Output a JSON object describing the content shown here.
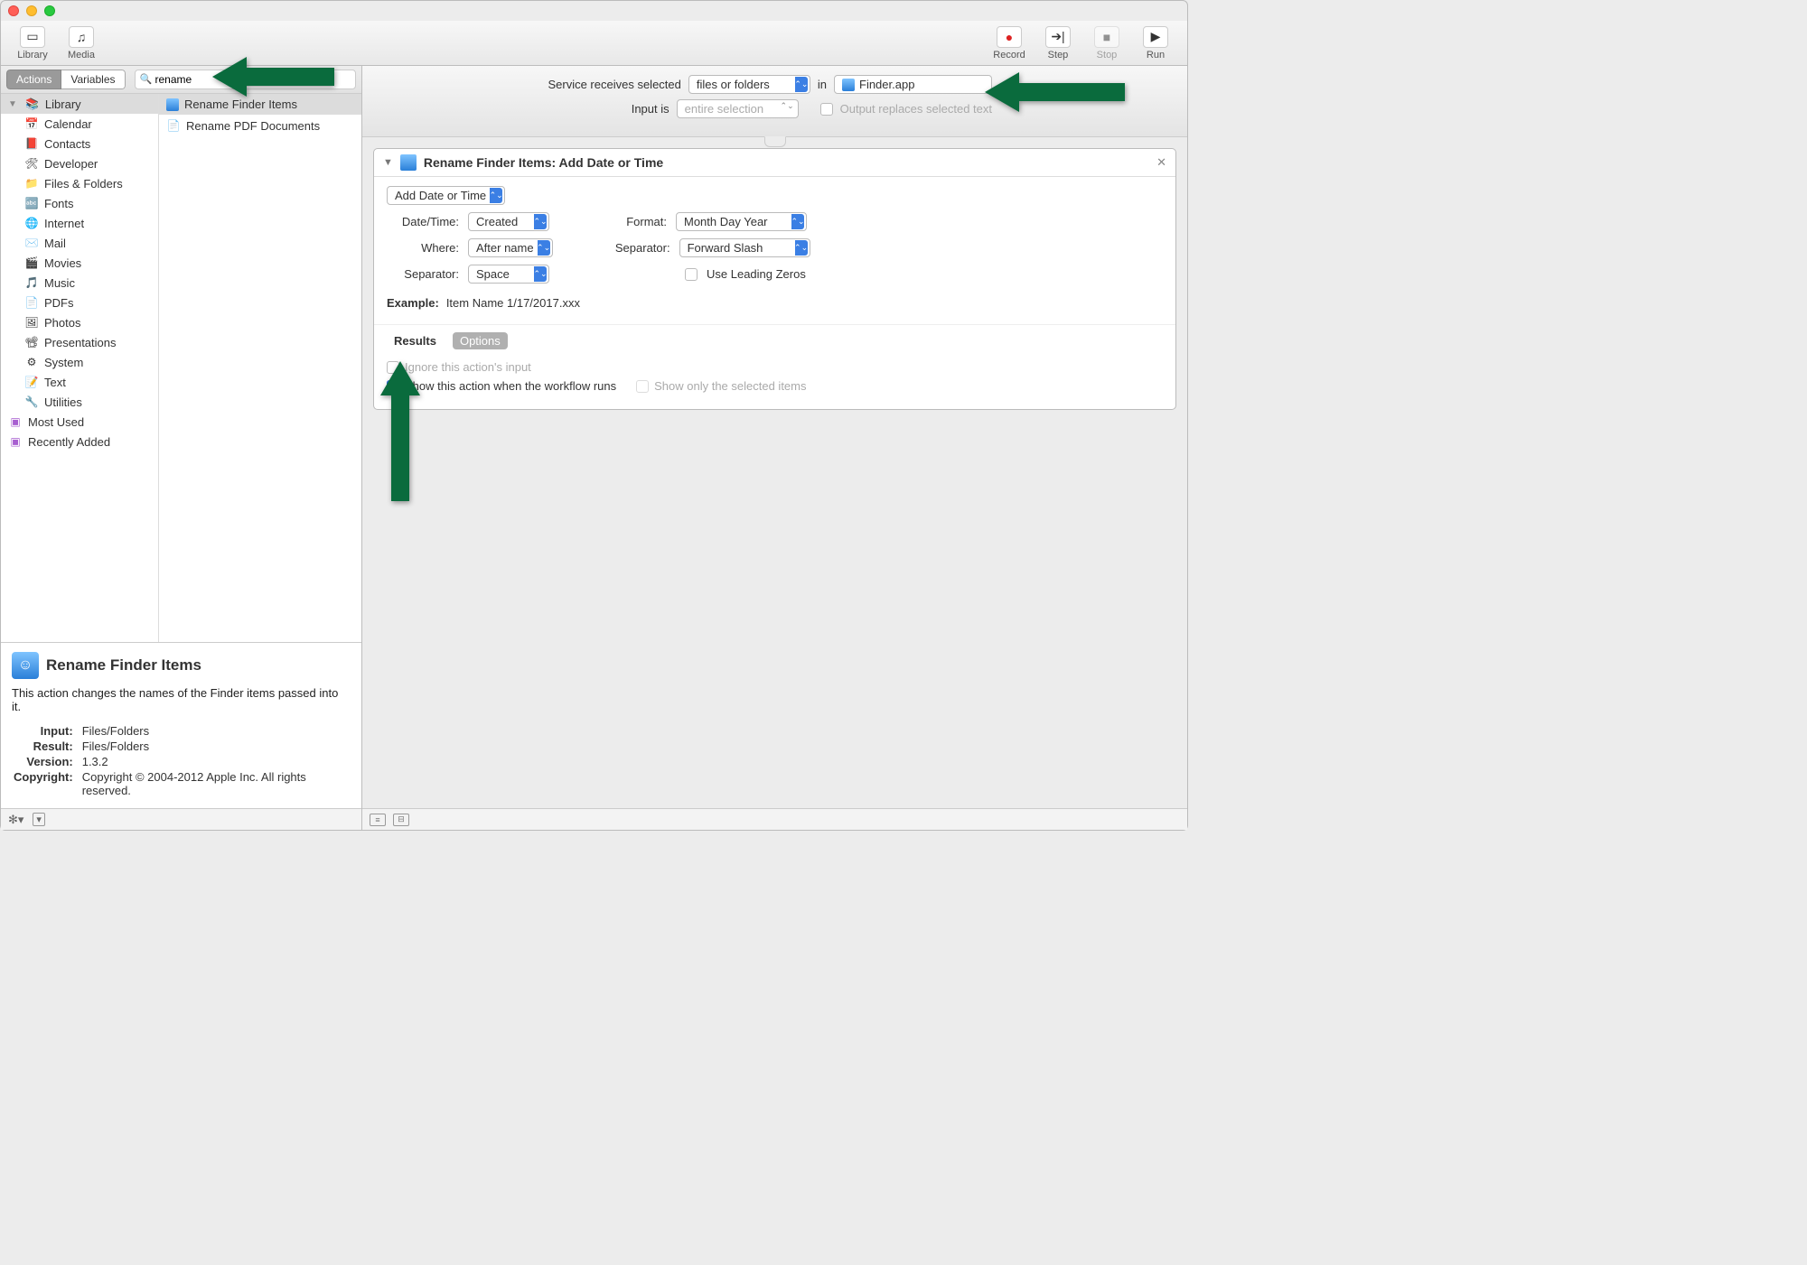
{
  "toolbar": {
    "library": "Library",
    "media": "Media",
    "record": "Record",
    "step": "Step",
    "stop": "Stop",
    "run": "Run"
  },
  "sidebar": {
    "tabs": {
      "actions": "Actions",
      "variables": "Variables"
    },
    "search": "rename",
    "categories": {
      "library": "Library",
      "items": [
        "Calendar",
        "Contacts",
        "Developer",
        "Files & Folders",
        "Fonts",
        "Internet",
        "Mail",
        "Movies",
        "Music",
        "PDFs",
        "Photos",
        "Presentations",
        "System",
        "Text",
        "Utilities"
      ],
      "mostUsed": "Most Used",
      "recentlyAdded": "Recently Added"
    },
    "results": {
      "r0": "Rename Finder Items",
      "r1": "Rename PDF Documents"
    }
  },
  "info": {
    "title": "Rename Finder Items",
    "desc": "This action changes the names of the Finder items passed into it.",
    "inputLabel": "Input:",
    "inputVal": "Files/Folders",
    "resultLabel": "Result:",
    "resultVal": "Files/Folders",
    "versionLabel": "Version:",
    "versionVal": "1.3.2",
    "copyrightLabel": "Copyright:",
    "copyrightVal": "Copyright © 2004-2012 Apple Inc.  All rights reserved."
  },
  "service": {
    "receivesLabel": "Service receives selected",
    "receivesVal": "files or folders",
    "inWord": "in",
    "appVal": "Finder.app",
    "inputIsLabel": "Input is",
    "inputIsVal": "entire selection",
    "outputReplaces": "Output replaces selected text"
  },
  "action": {
    "title": "Rename Finder Items: Add Date or Time",
    "mode": "Add Date or Time",
    "labels": {
      "datetime": "Date/Time:",
      "where": "Where:",
      "sep1": "Separator:",
      "format": "Format:",
      "sep2": "Separator:"
    },
    "values": {
      "datetime": "Created",
      "where": "After name",
      "sep1": "Space",
      "format": "Month Day Year",
      "sep2": "Forward Slash"
    },
    "leadingZeros": "Use Leading Zeros",
    "exampleLabel": "Example:",
    "exampleVal": "Item Name 1/17/2017.xxx",
    "tabs": {
      "results": "Results",
      "options": "Options"
    },
    "options": {
      "ignore": "Ignore this action's input",
      "show": "Show this action when the workflow runs",
      "showOnly": "Show only the selected items"
    }
  }
}
